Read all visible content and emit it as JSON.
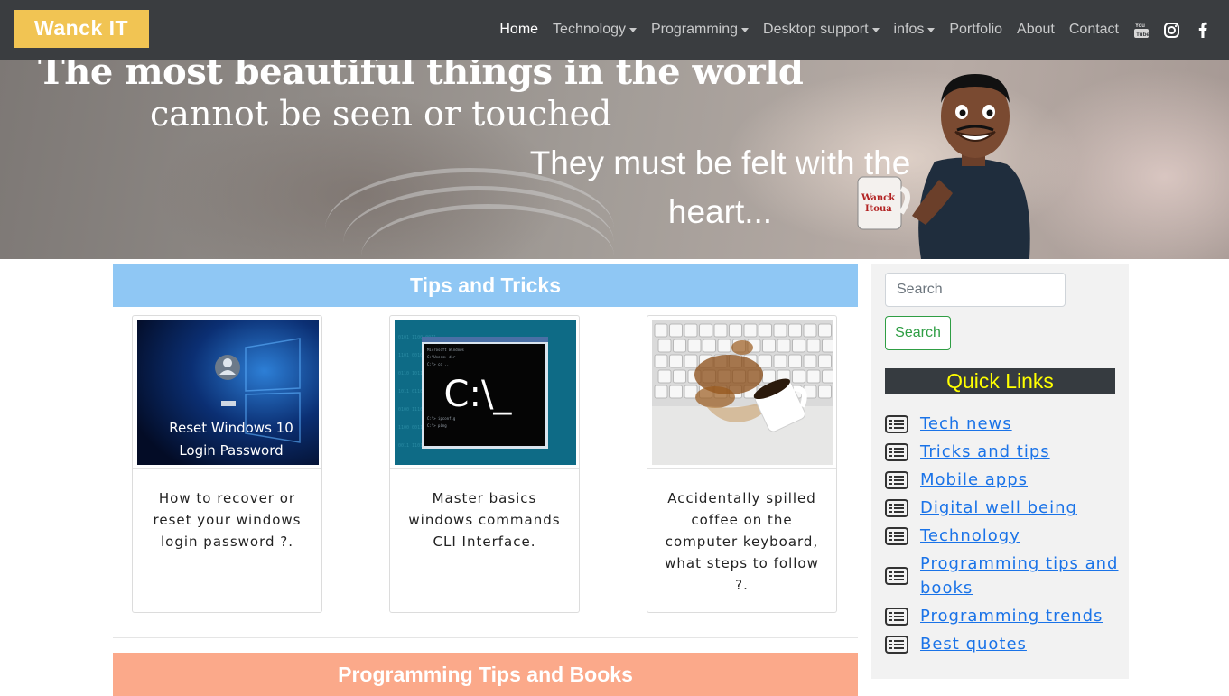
{
  "navbar": {
    "brand": "Wanck IT",
    "items": [
      {
        "label": "Home",
        "active": true,
        "dropdown": false
      },
      {
        "label": "Technology",
        "dropdown": true
      },
      {
        "label": "Programming",
        "dropdown": true
      },
      {
        "label": "Desktop support",
        "dropdown": true
      },
      {
        "label": "infos",
        "dropdown": true
      },
      {
        "label": "Portfolio",
        "dropdown": false
      },
      {
        "label": "About",
        "dropdown": false
      },
      {
        "label": "Contact",
        "dropdown": false
      }
    ],
    "social_icons": [
      "youtube-icon",
      "instagram-icon",
      "facebook-icon"
    ]
  },
  "hero": {
    "line1": "The most beautiful things in the world",
    "line2": "cannot be seen or touched",
    "line3": "They must be felt with the heart...",
    "mug_text": "Wanck Itoua"
  },
  "main": {
    "tips_title": "Tips and Tricks",
    "cards": [
      {
        "image_text": "Reset Windows 10 Login Password",
        "text": "How to recover or reset your windows login password ?."
      },
      {
        "image_text": "C:\\_",
        "text": "Master basics windows commands CLI Interface."
      },
      {
        "image_text": "",
        "text": "Accidentally spilled coffee on the computer keyboard, what steps to follow ?."
      }
    ],
    "programming_title": "Programming Tips and Books"
  },
  "sidebar": {
    "search_placeholder": "Search",
    "search_button": "Search",
    "quick_links_title": "Quick Links",
    "links": [
      "Tech news",
      "Tricks and tips",
      "Mobile apps",
      "Digital well being",
      "Technology",
      "Programming tips and books",
      "Programming trends",
      "Best quotes"
    ]
  },
  "colors": {
    "navbar_bg": "#3a3d40",
    "brand_bg": "#f1c453",
    "tips_bar": "#8fc7f4",
    "programming_bar": "#fba98a",
    "quick_links_bg": "#363b40",
    "quick_links_text": "#ffff00",
    "link": "#1a73e8",
    "search_button": "#2f9e44"
  }
}
